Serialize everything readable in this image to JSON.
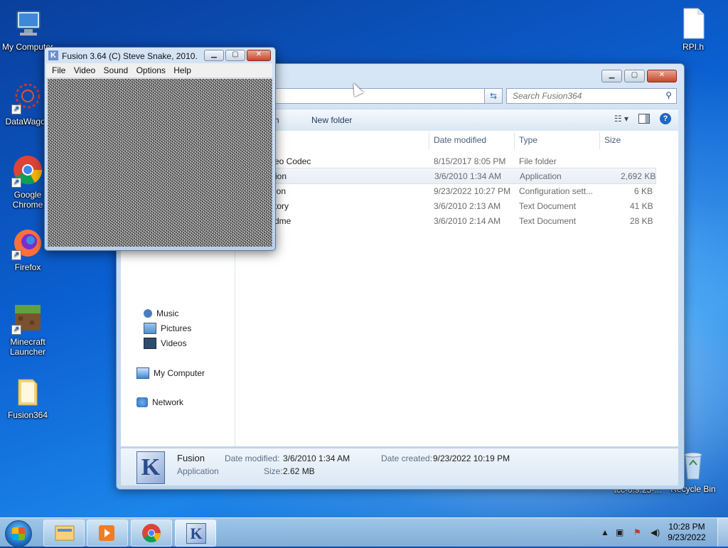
{
  "desktop": {
    "icons_left": [
      {
        "label": "My Computer",
        "icon": "computer-icon"
      },
      {
        "label": "DataWagon",
        "icon": "datawagon-icon"
      },
      {
        "label": "Google Chrome",
        "icon": "chrome-icon"
      },
      {
        "label": "Firefox",
        "icon": "firefox-icon"
      },
      {
        "label": "Minecraft Launcher",
        "icon": "minecraft-icon"
      },
      {
        "label": "Fusion364",
        "icon": "folder-icon"
      }
    ],
    "icons_right": [
      {
        "label": "RPI.h",
        "icon": "file-icon"
      },
      {
        "label": "tcc-0.9.25-...",
        "icon": "file-icon"
      },
      {
        "label": "Recycle Bin",
        "icon": "recycle-bin-icon"
      }
    ]
  },
  "fusion_window": {
    "title": "Fusion 3.64 (C) Steve Snake, 2010.",
    "menu": [
      "File",
      "Video",
      "Sound",
      "Options",
      "Help"
    ]
  },
  "explorer": {
    "search_placeholder": "Search Fusion364",
    "toolbar": {
      "partial_left": "h",
      "new_folder": "New folder"
    },
    "nav": [
      {
        "label": "Music",
        "icon": "music-icon"
      },
      {
        "label": "Pictures",
        "icon": "pictures-icon"
      },
      {
        "label": "Videos",
        "icon": "videos-icon"
      },
      {
        "label": "My Computer",
        "icon": "computer-icon"
      },
      {
        "label": "Network",
        "icon": "network-icon"
      }
    ],
    "columns": {
      "date": "Date modified",
      "type": "Type",
      "size": "Size"
    },
    "rows": [
      {
        "name": "eo Codec",
        "date": "8/15/2017 8:05 PM",
        "type": "File folder",
        "size": ""
      },
      {
        "name": "ion",
        "date": "3/6/2010 1:34 AM",
        "type": "Application",
        "size": "2,692 KB"
      },
      {
        "name": "ion",
        "date": "9/23/2022 10:27 PM",
        "type": "Configuration sett...",
        "size": "6 KB"
      },
      {
        "name": "tory",
        "date": "3/6/2010 2:13 AM",
        "type": "Text Document",
        "size": "41 KB"
      },
      {
        "name": "dme",
        "date": "3/6/2010 2:14 AM",
        "type": "Text Document",
        "size": "28 KB"
      }
    ],
    "details": {
      "name": "Fusion",
      "kind": "Application",
      "date_modified_label": "Date modified:",
      "date_modified": "3/6/2010 1:34 AM",
      "date_created_label": "Date created:",
      "date_created": "9/23/2022 10:19 PM",
      "size_label": "Size:",
      "size": "2.62 MB"
    }
  },
  "taskbar": {
    "clock_time": "10:28 PM",
    "clock_date": "9/23/2022"
  }
}
